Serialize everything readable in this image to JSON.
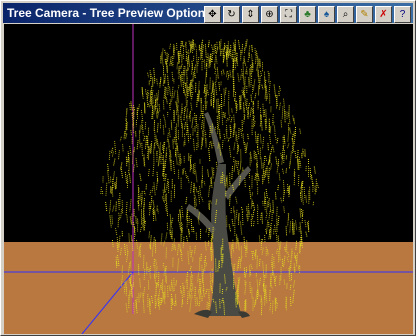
{
  "window": {
    "title": "Tree Camera - Tree Preview Options"
  },
  "toolbar": {
    "buttons": [
      {
        "name": "pan-icon",
        "glyph": "✥",
        "color": "#000000"
      },
      {
        "name": "rotate-icon",
        "glyph": "↻",
        "color": "#000000"
      },
      {
        "name": "zoom-icon",
        "glyph": "⇕",
        "color": "#000000"
      },
      {
        "name": "orbit-icon",
        "glyph": "⊕",
        "color": "#000000"
      },
      {
        "name": "zoom-extents-icon",
        "glyph": "⛶",
        "color": "#000000"
      },
      {
        "name": "tree-light-icon",
        "glyph": "♣",
        "color": "#2a7a2a"
      },
      {
        "name": "tree-shade-icon",
        "glyph": "♠",
        "color": "#1a5a9a"
      },
      {
        "name": "magnifier-icon",
        "glyph": "⌕",
        "color": "#000000"
      },
      {
        "name": "edit-icon",
        "glyph": "✎",
        "color": "#b08000"
      },
      {
        "name": "disable-icon",
        "glyph": "✗",
        "color": "#cc0000"
      },
      {
        "name": "help-icon",
        "glyph": "?",
        "color": "#000080"
      }
    ]
  },
  "scene": {
    "sky_color": "#000000",
    "ground_color": "#b87840",
    "foliage_color": "#e8e020",
    "trunk_color": "#4a4a44",
    "axis_x_color": "#3030ff",
    "axis_y_color": "#c030c0"
  }
}
